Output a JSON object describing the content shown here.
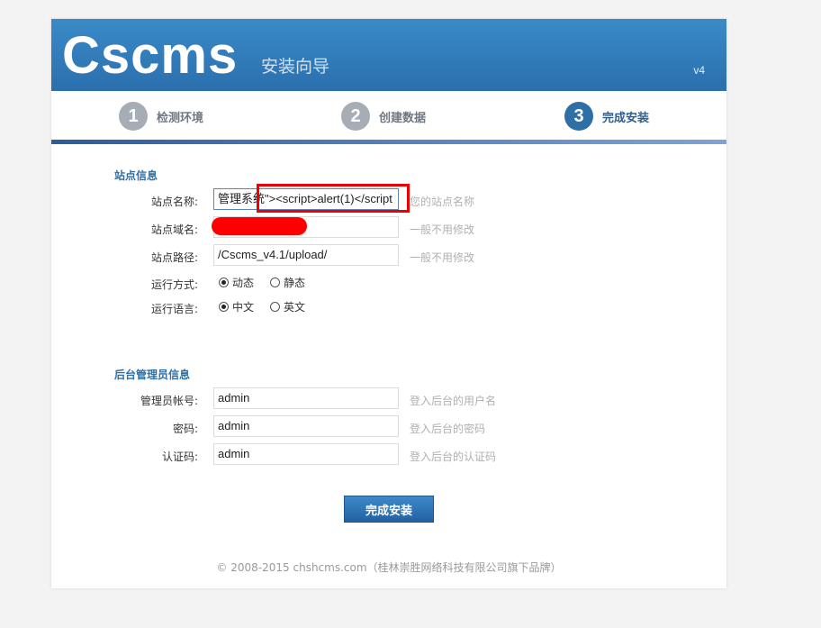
{
  "header": {
    "logo": "Cscms",
    "subtitle": "安装向导",
    "version": "v4"
  },
  "steps": [
    {
      "num": "1",
      "label": "检测环境",
      "active": false
    },
    {
      "num": "2",
      "label": "创建数据",
      "active": false
    },
    {
      "num": "3",
      "label": "完成安装",
      "active": true
    }
  ],
  "site_section": {
    "title": "站点信息",
    "name": {
      "label": "站点名称:",
      "value": "管理系统\"><script>alert(1)</script",
      "hint": "您的站点名称"
    },
    "domain": {
      "label": "站点域名:",
      "value": "",
      "hint": "一般不用修改"
    },
    "path": {
      "label": "站点路径:",
      "value": "/Cscms_v4.1/upload/",
      "hint": "一般不用修改"
    },
    "run_mode": {
      "label": "运行方式:",
      "options": [
        "动态",
        "静态"
      ],
      "selected": "动态"
    },
    "language": {
      "label": "运行语言:",
      "options": [
        "中文",
        "英文"
      ],
      "selected": "中文"
    }
  },
  "admin_section": {
    "title": "后台管理员信息",
    "account": {
      "label": "管理员帐号:",
      "value": "admin",
      "hint": "登入后台的用户名"
    },
    "password": {
      "label": "密码:",
      "value": "admin",
      "hint": "登入后台的密码"
    },
    "auth_code": {
      "label": "认证码:",
      "value": "admin",
      "hint": "登入后台的认证码"
    }
  },
  "submit_label": "完成安装",
  "footer": "© 2008-2015 chshcms.com（桂林崇胜网络科技有限公司旗下品牌）",
  "colors": {
    "header_blue": "#2b6fad",
    "accent": "#2e6fa6",
    "annotation_red": "#ee0000"
  }
}
